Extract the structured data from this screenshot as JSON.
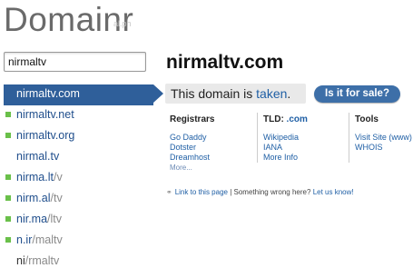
{
  "header": {
    "logo": "Domainr",
    "logo_sub": "al.ph"
  },
  "search": {
    "value": "nirmaltv"
  },
  "results": [
    {
      "main": "nirmaltv.com",
      "dim": "",
      "state": "active"
    },
    {
      "main": "nirmaltv.net",
      "dim": "",
      "state": "available"
    },
    {
      "main": "nirmaltv.org",
      "dim": "",
      "state": "available"
    },
    {
      "main": "nirmal.tv",
      "dim": "",
      "state": "taken"
    },
    {
      "main": "nirma.lt",
      "dim": "/v",
      "state": "available"
    },
    {
      "main": "nirm.al",
      "dim": "/tv",
      "state": "available"
    },
    {
      "main": "nir.ma",
      "dim": "/ltv",
      "state": "available"
    },
    {
      "main": "n.ir",
      "dim": "/maltv",
      "state": "available"
    },
    {
      "main": "ni",
      "dim": "/rmaltv",
      "state": "plain"
    }
  ],
  "main": {
    "domain": "nirmaltv.com",
    "status_prefix": "This domain is ",
    "status_word": "taken",
    "status_suffix": ".",
    "sale_button": "Is it for sale?"
  },
  "registrars": {
    "title": "Registrars",
    "links": [
      "Go Daddy",
      "Dotster",
      "Dreamhost"
    ],
    "more": "More..."
  },
  "tld": {
    "title": "TLD: ",
    "tld_value": ".com",
    "links": [
      "Wikipedia",
      "IANA",
      "More Info"
    ]
  },
  "tools": {
    "title": "Tools",
    "links": [
      "Visit Site (www)",
      "WHOIS"
    ]
  },
  "footer": {
    "link_text": "Link to this page",
    "separator": " | ",
    "wrong_text": "Something wrong here?",
    "let_us_know": "Let us know!"
  },
  "colors": {
    "active": "#2f5f9a",
    "available_marker": "#6ac04a",
    "link": "#1f5fa5"
  }
}
